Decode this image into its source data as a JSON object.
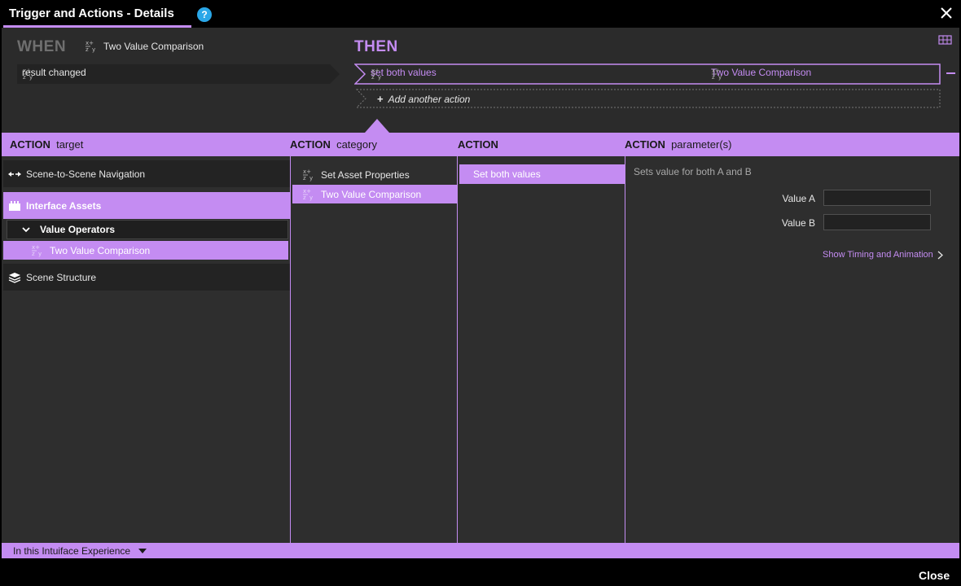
{
  "window": {
    "title": "Trigger and Actions - Details",
    "help_glyph": "?",
    "close_label": "Close"
  },
  "when": {
    "label": "WHEN",
    "source": "Two Value Comparison",
    "trigger": "result changed"
  },
  "then": {
    "label": "THEN",
    "action_name": "set both values",
    "action_target": "Two Value Comparison",
    "add_action": "Add another action"
  },
  "columns": {
    "target": {
      "strong": "ACTION",
      "rest": "target"
    },
    "category": {
      "strong": "ACTION",
      "rest": "category"
    },
    "action": {
      "strong": "ACTION",
      "rest": ""
    },
    "params": {
      "strong": "ACTION",
      "rest": "parameter(s)"
    }
  },
  "targets": {
    "scene_nav": "Scene-to-Scene Navigation",
    "interface_assets": "Interface Assets",
    "value_operators": "Value Operators",
    "two_value": "Two Value Comparison",
    "scene_structure": "Scene Structure"
  },
  "categories": {
    "set_asset": "Set Asset Properties",
    "two_value": "Two Value Comparison"
  },
  "actions": {
    "selected": "Set both values"
  },
  "params": {
    "description": "Sets value for both A and B",
    "value_a_label": "Value A",
    "value_a": "",
    "value_b_label": "Value B",
    "value_b": "",
    "timing_link": "Show Timing and Animation"
  },
  "footer": {
    "scope": "In this Intuiface Experience"
  },
  "colors": {
    "accent": "#c48cf2",
    "help": "#2aa7e8"
  }
}
